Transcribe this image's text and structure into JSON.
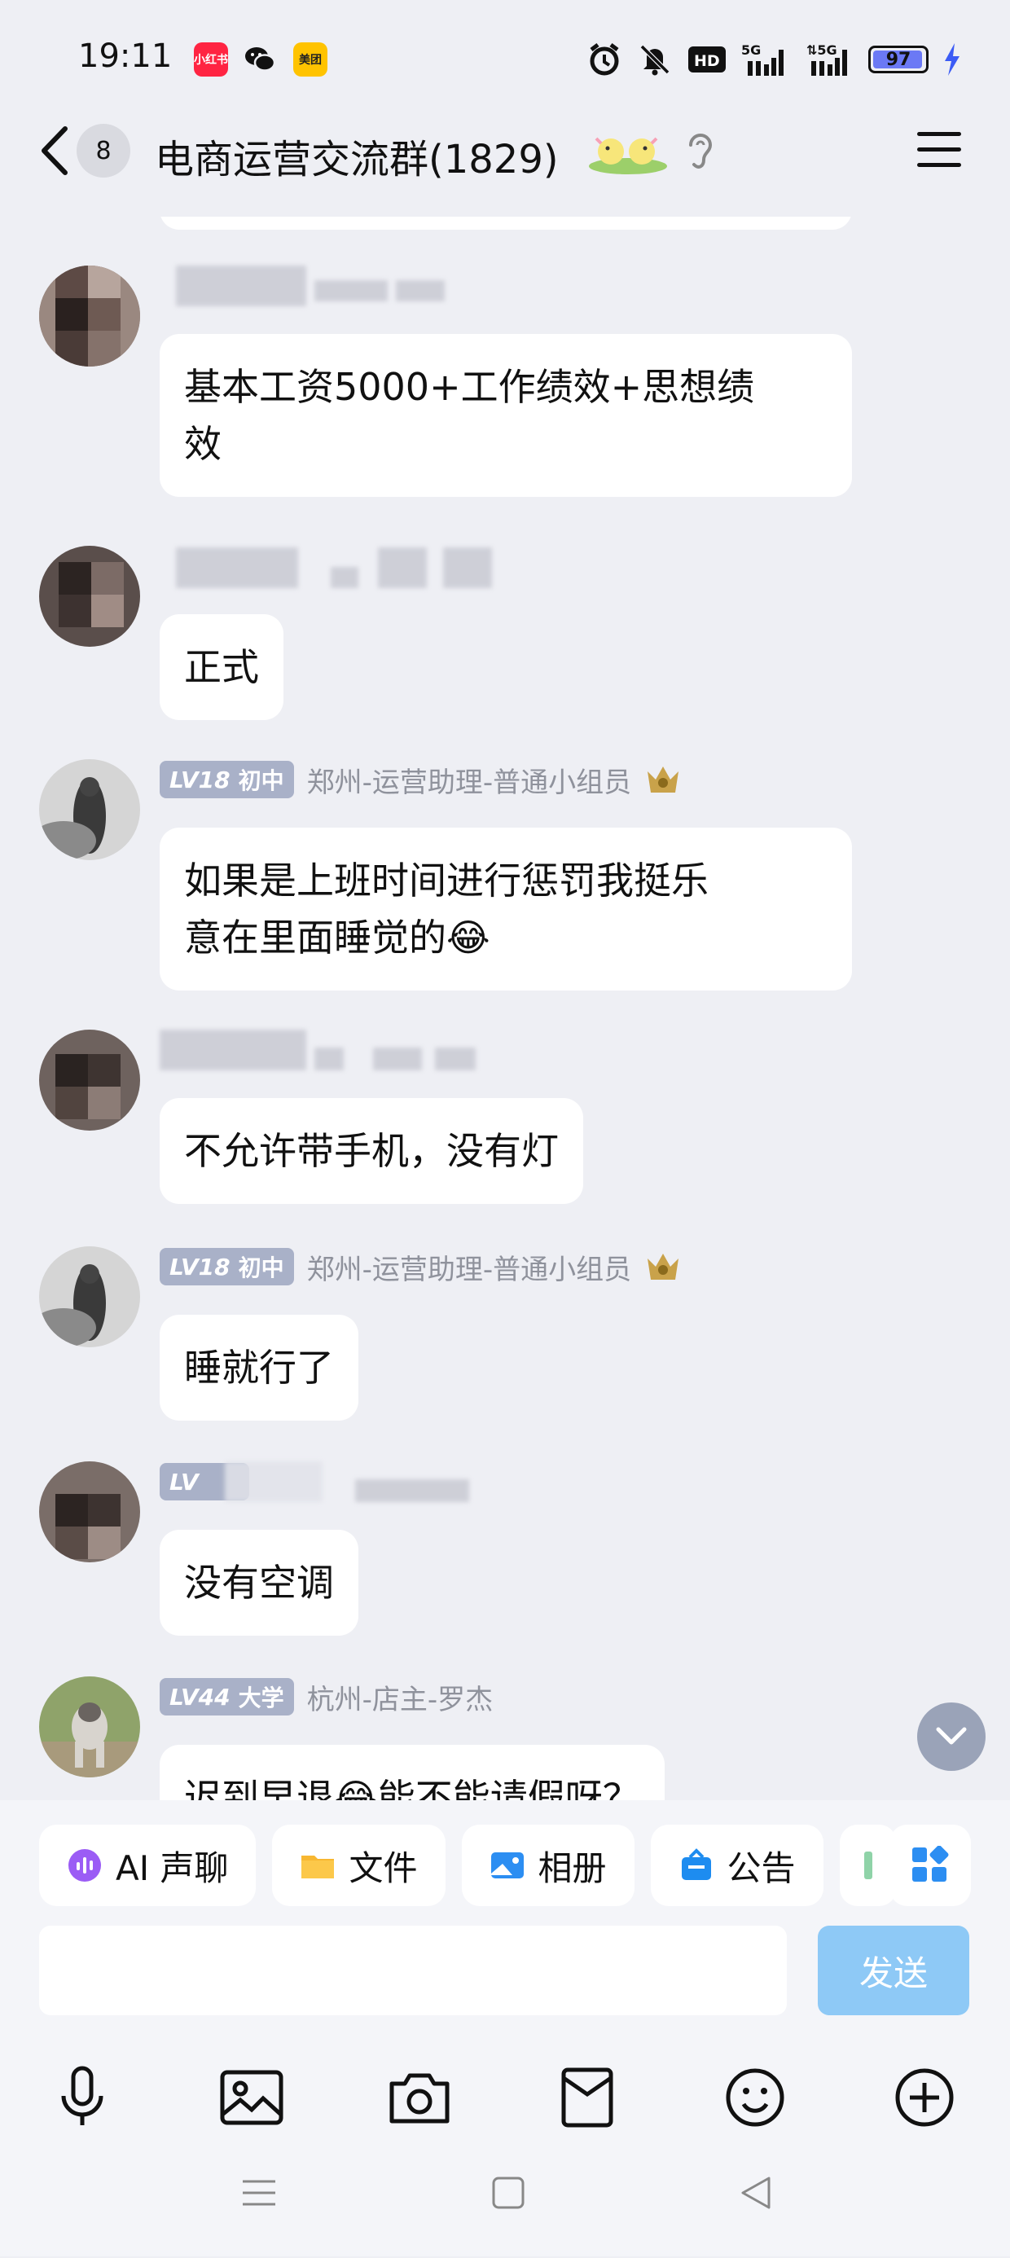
{
  "status_bar": {
    "time": "19:11",
    "apps": [
      "小红书",
      "微信",
      "美团"
    ],
    "network": [
      "HD",
      "5G",
      "5G"
    ],
    "battery": "97",
    "battery_level": 0.97
  },
  "header": {
    "unread_count": "8",
    "title": "电商运营交流群(1829)"
  },
  "messages": [
    {
      "sender_tag": "",
      "sender": "",
      "text": "基本工资5000+工作绩效+思想绩效",
      "lines": [
        "基本工资5000+工作绩效+思想绩",
        "效"
      ]
    },
    {
      "sender_tag": "",
      "sender": "",
      "text": "正式"
    },
    {
      "lv": "LV18",
      "level_name": "初中",
      "sender": "郑州-运营助理-普通小组员",
      "text": "如果是上班时间进行惩罚我挺乐意在里面睡觉的😂",
      "lines": [
        "如果是上班时间进行惩罚我挺乐",
        "意在里面睡觉的😂"
      ]
    },
    {
      "sender": "",
      "text": "不允许带手机，没有灯"
    },
    {
      "lv": "LV18",
      "level_name": "初中",
      "sender": "郑州-运营助理-普通小组员",
      "text": "睡就行了"
    },
    {
      "lv": "LV",
      "sender": "",
      "text": "没有空调"
    },
    {
      "lv": "LV44",
      "level_name": "大学",
      "sender": "杭州-店主-罗杰",
      "text": "迟到早退😂能不能请假呀？"
    }
  ],
  "toolbar": {
    "chips": [
      {
        "label": "AI 声聊",
        "icon": "ai-voice-icon"
      },
      {
        "label": "文件",
        "icon": "folder-icon"
      },
      {
        "label": "相册",
        "icon": "album-icon"
      },
      {
        "label": "公告",
        "icon": "announcement-icon"
      }
    ],
    "input_placeholder": "",
    "send_label": "发送"
  },
  "colors": {
    "background": "#eeeff4",
    "bubble": "#ffffff",
    "level_badge": "#a9b1c8",
    "send_disabled": "#8ec9f6",
    "role_text": "#8f929c"
  }
}
